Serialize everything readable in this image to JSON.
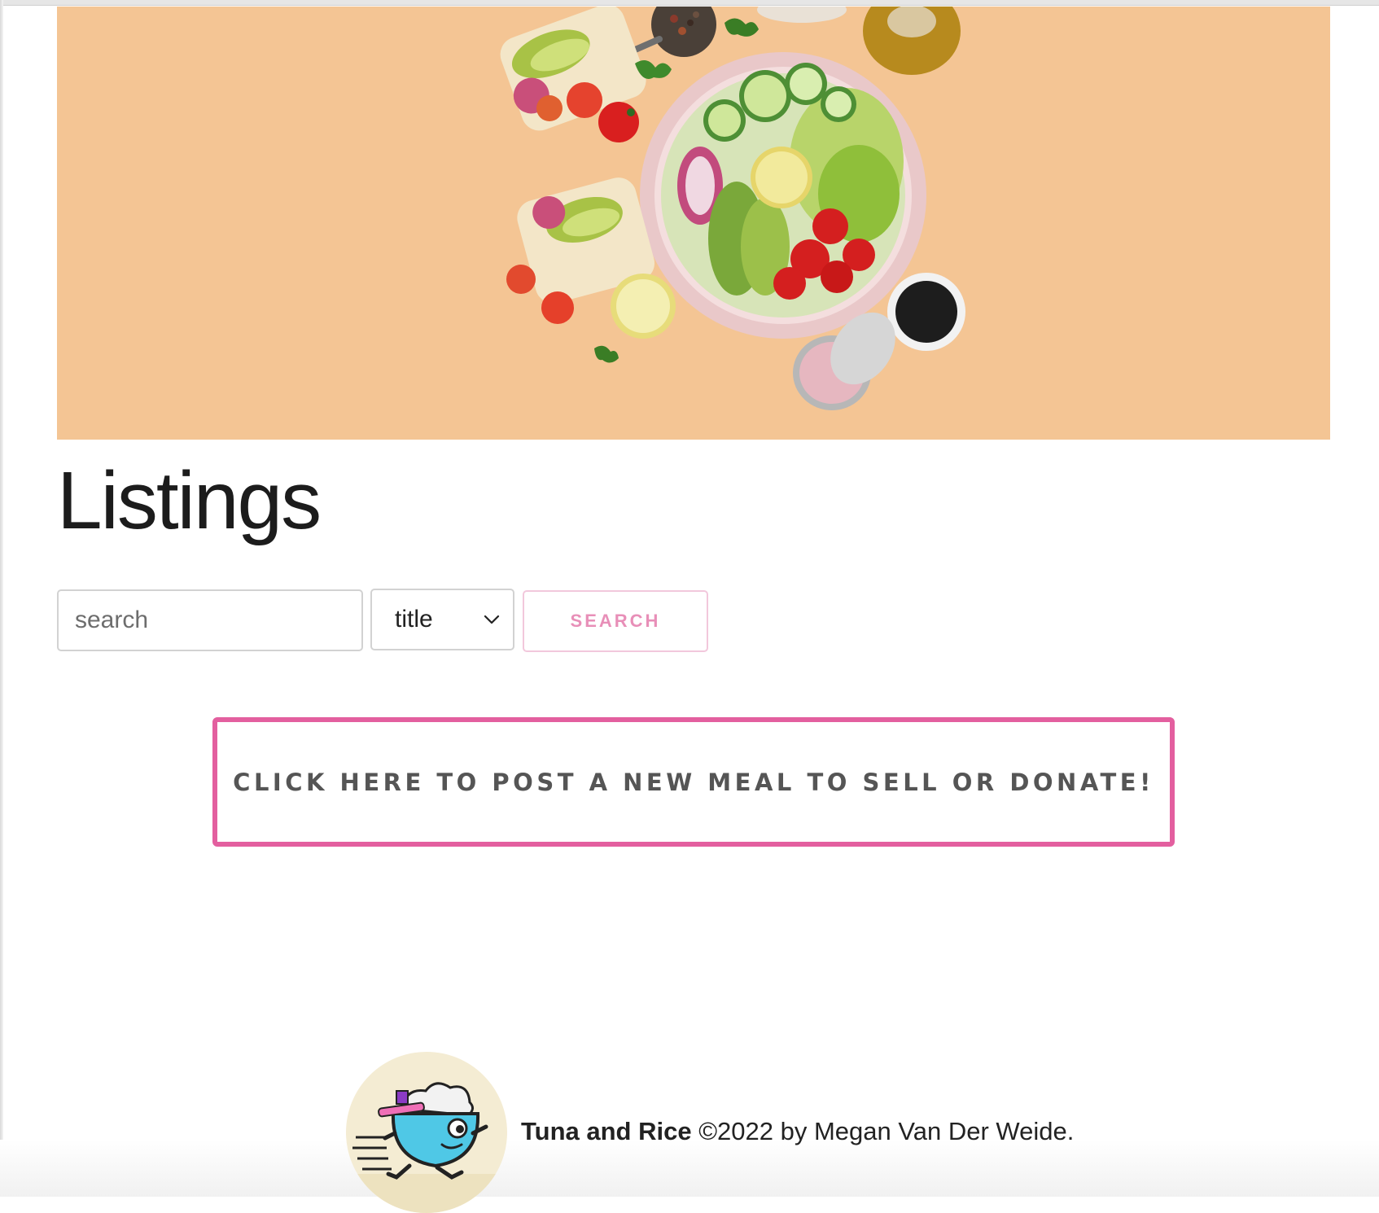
{
  "page": {
    "title": "Listings"
  },
  "search": {
    "placeholder": "search",
    "value": "",
    "field_selected": "title",
    "button_label": "SEARCH"
  },
  "cta": {
    "label": "CLICK HERE TO POST A NEW MEAL TO SELL OR DONATE!"
  },
  "footer": {
    "brand": "Tuna and Rice",
    "copyright": "©2022 by Megan Van Der Weide."
  },
  "colors": {
    "hero_bg": "#f4c594",
    "accent_pink": "#e35f9f",
    "search_button_text": "#e88fb8"
  },
  "icons": {
    "select_arrow": "chevron-down-icon",
    "logo": "running-rice-bowl-mascot"
  }
}
